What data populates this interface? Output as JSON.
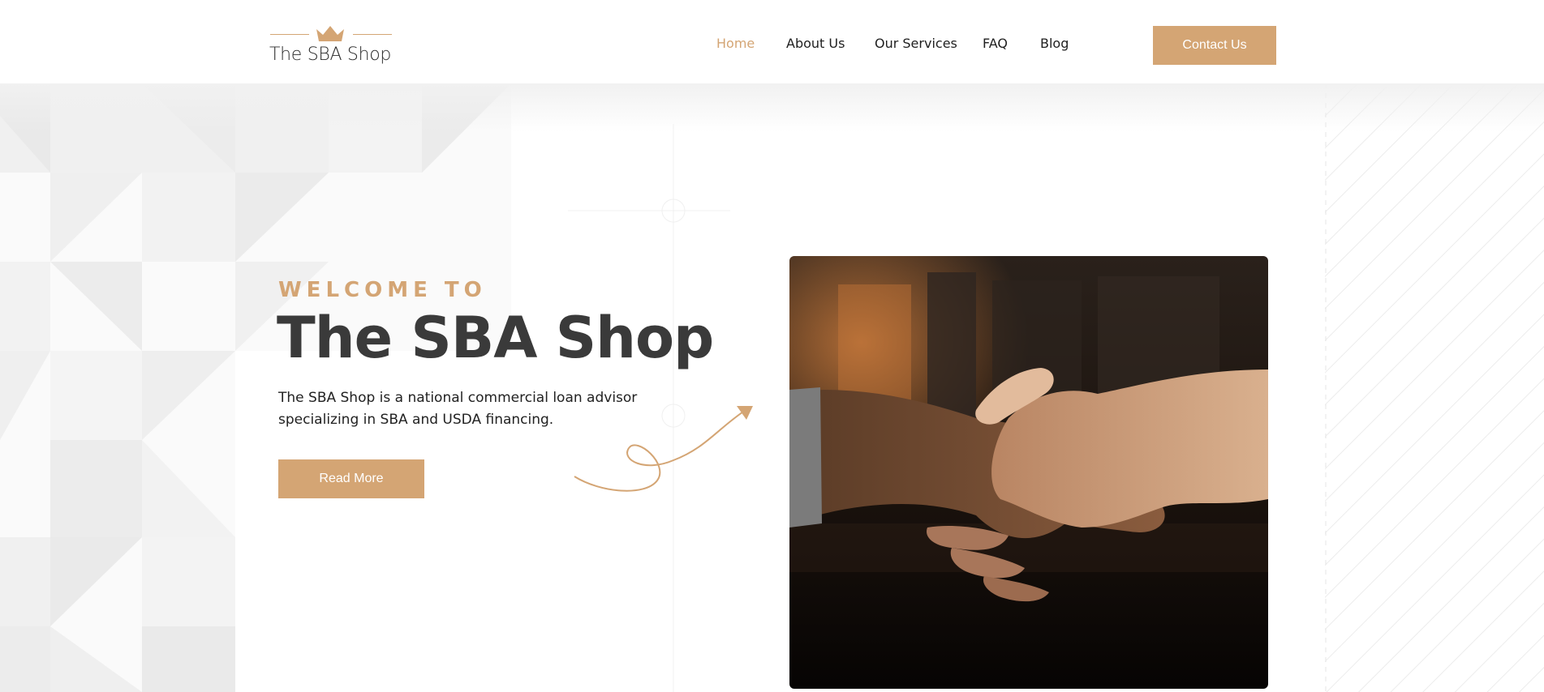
{
  "brand": {
    "name": "The SBA Shop",
    "accent_color": "#d4a574",
    "logo_icon": "crown-icon"
  },
  "nav": {
    "items": [
      {
        "label": "Home",
        "active": true
      },
      {
        "label": "About Us",
        "active": false
      },
      {
        "label": "Our Services",
        "active": false
      },
      {
        "label": "FAQ",
        "active": false
      },
      {
        "label": "Blog",
        "active": false
      }
    ],
    "contact_label": "Contact Us"
  },
  "hero": {
    "eyebrow": "WELCOME TO",
    "title": "The SBA Shop",
    "description": "The SBA Shop is a national commercial loan advisor specializing in SBA and USDA financing.",
    "button_label": "Read More",
    "image_subject": "handshake"
  }
}
